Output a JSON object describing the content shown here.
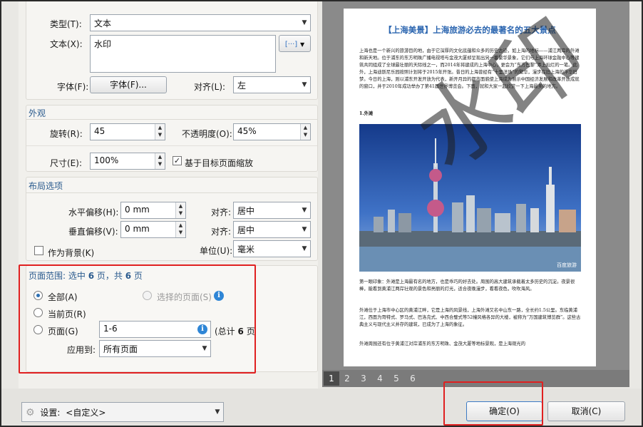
{
  "text_settings": {
    "type_label": "类型(T):",
    "type_value": "文本",
    "text_label": "文本(X):",
    "text_value": "水印",
    "insert_btn": "[···]",
    "font_label": "字体(F):",
    "font_btn": "字体(F)...",
    "align_label": "对齐(L):",
    "align_value": "左"
  },
  "appearance": {
    "title": "外观",
    "rotation_label": "旋转(R):",
    "rotation_value": "45",
    "opacity_label": "不透明度(O):",
    "opacity_value": "45%",
    "size_label": "尺寸(E):",
    "size_value": "100%",
    "scale_checked": true,
    "scale_label": "基于目标页面缩放"
  },
  "layout": {
    "title": "布局选项",
    "h_offset_label": "水平偏移(H):",
    "h_offset_value": "0 mm",
    "h_align_label": "对齐:",
    "h_align_value": "居中",
    "v_offset_label": "垂直偏移(V):",
    "v_offset_value": "0 mm",
    "v_align_label": "对齐:",
    "v_align_value": "居中",
    "background_checked": false,
    "background_label": "作为背景(K)",
    "unit_label": "单位(U):",
    "unit_value": "毫米"
  },
  "page_range": {
    "title_prefix": "页面范围: 选中",
    "selected": "6",
    "title_mid": "页，共",
    "total": "6",
    "title_suffix": "页",
    "all_label": "全部(A)",
    "selected_pages_label": "选择的页面(S)",
    "current_label": "当前页(R)",
    "pages_label": "页面(G)",
    "pages_value": "1-6",
    "total_text_prefix": "(总计",
    "total_text_count": "6",
    "total_text_suffix": "页",
    "apply_label": "应用到:",
    "apply_value": "所有页面",
    "selected_option": "all"
  },
  "preview": {
    "title": "【上海美景】上海旅游必去的最著名的五大景点",
    "para1": "上海也是一个新兴的旅游目的地，由于它深厚的文化底蕴和众多的历史古迹，如上海的地标——浦江两岸的外滩和新天地。位于浦东的东方明珠广播电视塔与金茂大厦却呈现出另一番繁华景象，它们与上海环球金融中心等建筑共同组成了全球最壮丽的天际线之一，而2014年将建成的上海中心，更会为“东方巴黎”添上灿烂的一笔。此外，上海迪斯尼乐园按照计划将于2015年开张。昔日的上海曾经有“十里洋场”的繁华，漫步在旧上海的浮华旧梦。今日的上海，则以浦东开发开放为代表，新开月异的都市面貌使上海成为展示中国经济发展和改革开放成就的窗口，并于2010年成功举办了第41届世界博览会。下面，就和大家一起欣赏一下上海最美的地方。",
    "section": "1.外滩",
    "photo_mark": "百度旅游",
    "para2": "第一眼印象：外滩是上海最有名的地方，也是乖巧的好去处。周围的高大建筑承载着太多历史的沉淀。夜景很棒，能看到黄浦江两岸壮观的景色和亮丽的灯光，适合夜晚漫步，看看夜色，吹吹海风。",
    "para3": "外滩位于上海市中心区的黄浦江畔，它是上海的风景线，上海外滩又名中山东一路，全长约1.5公里。东临黄浦江，西面为哥特式、罗马式、巴洛克式、中西合璧式等52幢风格各异的大楼，被称为“万国建筑博览群”。这些古典主义与现代主义并存的建筑，已成为了上海的象征。",
    "para4": "外滩周围还有位于黄浦江对岸浦东的东方明珠、金茂大厦等地标景观，是上海观光的",
    "watermark_text": "水印",
    "pages": [
      "1",
      "2",
      "3",
      "4",
      "5",
      "6"
    ],
    "current_page": "1"
  },
  "footer": {
    "settings_label": "设置:",
    "settings_value": "<自定义>",
    "ok_label": "确定(O)",
    "cancel_label": "取消(C)"
  },
  "colors": {
    "accent_blue": "#2b5b8e",
    "highlight_red": "#e02020",
    "title_blue": "#2c66b0"
  }
}
